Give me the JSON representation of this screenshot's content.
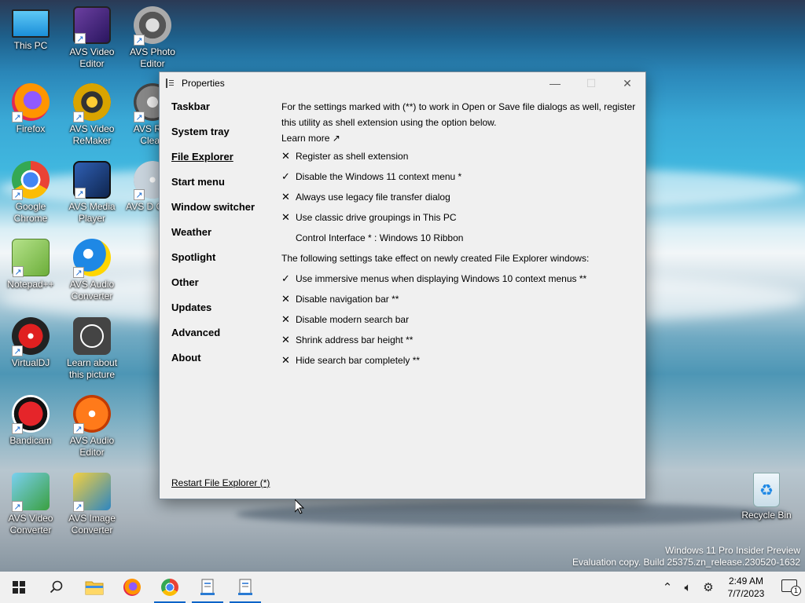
{
  "desktop": {
    "icons": [
      {
        "label": "This PC",
        "icon": "monitor-icon"
      },
      {
        "label": "AVS Video Editor",
        "icon": "film-icon"
      },
      {
        "label": "AVS Photo Editor",
        "icon": "photo-icon"
      },
      {
        "label": "Firefox",
        "icon": "firefox-icon"
      },
      {
        "label": "AVS Video ReMaker",
        "icon": "film-reel-icon"
      },
      {
        "label": "AVS Reg Clean",
        "icon": "gear-icon"
      },
      {
        "label": "Google Chrome",
        "icon": "chrome-icon"
      },
      {
        "label": "AVS Media Player",
        "icon": "play-icon"
      },
      {
        "label": "AVS D Creat",
        "icon": "disc-icon"
      },
      {
        "label": "Notepad++",
        "icon": "notepad-icon"
      },
      {
        "label": "AVS Audio Converter",
        "icon": "audio-converter-icon"
      },
      {
        "label": "VirtualDJ",
        "icon": "vinyl-icon"
      },
      {
        "label": "Learn about this picture",
        "icon": "camera-icon"
      },
      {
        "label": "Bandicam",
        "icon": "record-icon"
      },
      {
        "label": "AVS Audio Editor",
        "icon": "waveform-icon"
      },
      {
        "label": "AVS Video Converter",
        "icon": "video-converter-icon"
      },
      {
        "label": "AVS Image Converter",
        "icon": "image-converter-icon"
      },
      {
        "label": "Recycle Bin",
        "icon": "recycle-bin-icon"
      }
    ],
    "watermark": {
      "line1": "Windows 11 Pro Insider Preview",
      "line2": "Evaluation copy. Build 25375.zn_release.230520-1632"
    }
  },
  "window": {
    "title": "Properties",
    "controls": {
      "minimize": "—",
      "maximize": "☐",
      "close": "✕"
    },
    "nav": [
      {
        "label": "Taskbar"
      },
      {
        "label": "System tray"
      },
      {
        "label": "File Explorer",
        "active": true
      },
      {
        "label": "Start menu"
      },
      {
        "label": "Window switcher"
      },
      {
        "label": "Weather"
      },
      {
        "label": "Spotlight"
      },
      {
        "label": "Other"
      },
      {
        "label": "Updates"
      },
      {
        "label": "Advanced"
      },
      {
        "label": "About"
      }
    ],
    "intro": "For the settings marked with (**) to work in Open or Save file dialogs as well, register this utility as shell extension using the option below.",
    "learn_more": "Learn more ↗",
    "options_top": [
      {
        "mark": "✕",
        "label": "Register as shell extension"
      },
      {
        "mark": "✓",
        "label": "Disable the Windows 11 context menu *"
      },
      {
        "mark": "✕",
        "label": "Always use legacy file transfer dialog"
      },
      {
        "mark": "✕",
        "label": "Use classic drive groupings in This PC"
      }
    ],
    "control_interface": "Control Interface * : Windows 10 Ribbon",
    "section_label": "The following settings take effect on newly created File Explorer windows:",
    "options_bottom": [
      {
        "mark": "✓",
        "label": "Use immersive menus when displaying Windows 10 context menus **"
      },
      {
        "mark": "✕",
        "label": "Disable navigation bar **"
      },
      {
        "mark": "✕",
        "label": "Disable modern search bar"
      },
      {
        "mark": "✕",
        "label": "Shrink address bar height **"
      },
      {
        "mark": "✕",
        "label": "Hide search bar completely **"
      }
    ],
    "restart_link": "Restart File Explorer (*)"
  },
  "taskbar": {
    "clock_time": "2:49 AM",
    "clock_date": "7/7/2023",
    "notification_count": "1"
  }
}
